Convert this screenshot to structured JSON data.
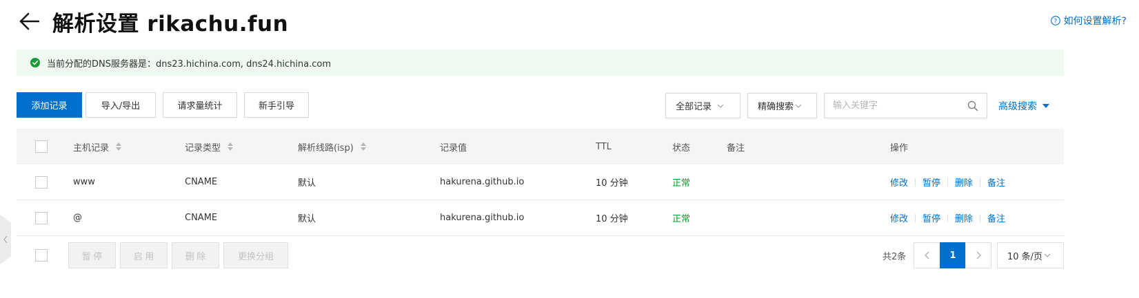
{
  "header": {
    "title": "解析设置 rikachu.fun",
    "help_link": "如何设置解析?",
    "back_icon": "arrow-left-icon",
    "help_icon": "question-circle-icon"
  },
  "dns_banner": {
    "text": "当前分配的DNS服务器是：dns23.hichina.com, dns24.hichina.com",
    "icon": "check-circle-icon",
    "background": "#eefaf1",
    "icon_color": "#1a9b3a"
  },
  "toolbar": {
    "add_record": "添加记录",
    "import_export": "导入/导出",
    "request_stats": "请求量统计",
    "beginner_guide": "新手引导"
  },
  "filters": {
    "record_filter": "全部记录",
    "search_mode": "精确搜索",
    "search_placeholder": "输入关键字",
    "advanced_search": "高级搜索"
  },
  "table": {
    "columns": {
      "host": "主机记录",
      "type": "记录类型",
      "line": "解析线路(isp)",
      "value": "记录值",
      "ttl": "TTL",
      "status": "状态",
      "remark": "备注",
      "actions": "操作"
    },
    "rows": [
      {
        "host": "www",
        "type": "CNAME",
        "line": "默认",
        "value": "hakurena.github.io",
        "ttl": "10 分钟",
        "status": "正常",
        "remark": "",
        "checked": false
      },
      {
        "host": "@",
        "type": "CNAME",
        "line": "默认",
        "value": "hakurena.github.io",
        "ttl": "10 分钟",
        "status": "正常",
        "remark": "",
        "checked": false
      }
    ],
    "row_actions": {
      "edit": "修改",
      "pause": "暂停",
      "delete": "删除",
      "remark": "备注"
    }
  },
  "bulk_actions": {
    "pause": "暂 停",
    "enable": "启 用",
    "delete": "删 除",
    "change_group": "更换分组"
  },
  "pagination": {
    "total": "共2条",
    "current_page": "1",
    "page_size": "10 条/页",
    "prev_icon": "chevron-left-icon",
    "next_icon": "chevron-right-icon"
  },
  "colors": {
    "primary": "#0070cc",
    "status_ok": "#00a32a"
  }
}
